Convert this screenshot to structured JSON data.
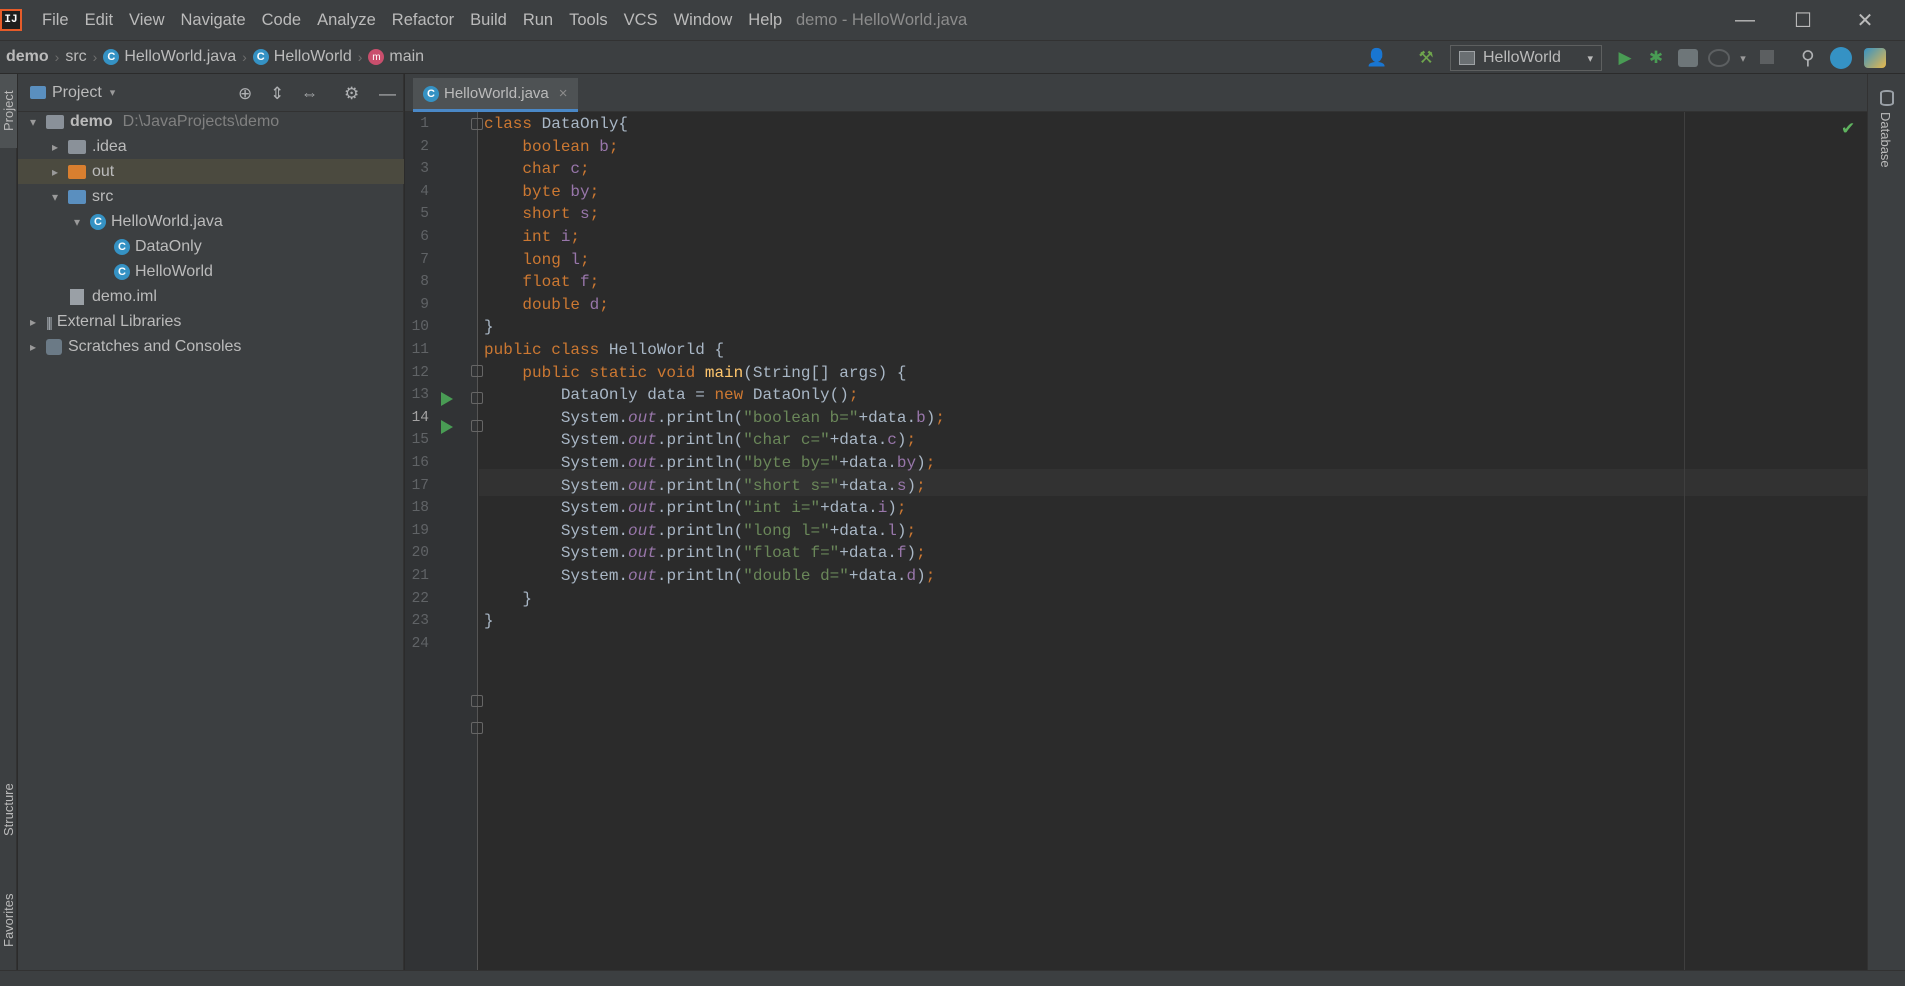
{
  "window": {
    "title": "demo - HelloWorld.java",
    "minimize_glyph": "—",
    "maximize_glyph": "☐",
    "close_glyph": "✕"
  },
  "menu": [
    "File",
    "Edit",
    "View",
    "Navigate",
    "Code",
    "Analyze",
    "Refactor",
    "Build",
    "Run",
    "Tools",
    "VCS",
    "Window",
    "Help"
  ],
  "breadcrumb": {
    "project": "demo",
    "folder": "src",
    "file": "HelloWorld.java",
    "class": "HelloWorld",
    "method": "main"
  },
  "toolbar": {
    "run_config": "HelloWorld"
  },
  "icons": {
    "class_glyph": "C",
    "method_glyph": "m",
    "chevron_right": "›",
    "chevron_expand": "▾",
    "chevron_collapse": "▸",
    "run": "▶",
    "debug": "✱",
    "search": "⚲",
    "hammer": "⚒",
    "user": "👤",
    "check": "✔",
    "gear": "⚙",
    "target": "⊕",
    "expand_all": "⇕",
    "collapse_all": "⇔",
    "hide": "—",
    "close_tab": "×"
  },
  "side_tabs": {
    "project": "Project",
    "structure": "Structure",
    "favorites": "Favorites",
    "database": "Database"
  },
  "project_panel": {
    "title": "Project",
    "tree": [
      {
        "label": "demo",
        "hint": "D:\\JavaProjects\\demo"
      },
      {
        "label": ".idea"
      },
      {
        "label": "out"
      },
      {
        "label": "src"
      },
      {
        "label": "HelloWorld.java"
      },
      {
        "label": "DataOnly"
      },
      {
        "label": "HelloWorld"
      },
      {
        "label": "demo.iml"
      },
      {
        "label": "External Libraries"
      },
      {
        "label": "Scratches and Consoles"
      }
    ]
  },
  "editor": {
    "tab_label": "HelloWorld.java",
    "current_line": 14,
    "line_numbers": [
      "1",
      "2",
      "3",
      "4",
      "5",
      "6",
      "7",
      "8",
      "9",
      "10",
      "11",
      "12",
      "13",
      "14",
      "15",
      "16",
      "17",
      "18",
      "19",
      "20",
      "21",
      "22",
      "23",
      "24"
    ],
    "lines": [
      [
        [
          "kw",
          "class "
        ],
        [
          "pl",
          "DataOnly{"
        ]
      ],
      [
        [
          "kw",
          "    boolean "
        ],
        [
          "fld",
          "b"
        ],
        [
          "kw",
          ";"
        ]
      ],
      [
        [
          "kw",
          "    char "
        ],
        [
          "fld",
          "c"
        ],
        [
          "kw",
          ";"
        ]
      ],
      [
        [
          "kw",
          "    byte "
        ],
        [
          "fld",
          "by"
        ],
        [
          "kw",
          ";"
        ]
      ],
      [
        [
          "kw",
          "    short "
        ],
        [
          "fld",
          "s"
        ],
        [
          "kw",
          ";"
        ]
      ],
      [
        [
          "kw",
          "    int "
        ],
        [
          "fld",
          "i"
        ],
        [
          "kw",
          ";"
        ]
      ],
      [
        [
          "kw",
          "    long "
        ],
        [
          "fld",
          "l"
        ],
        [
          "kw",
          ";"
        ]
      ],
      [
        [
          "kw",
          "    float "
        ],
        [
          "fld",
          "f"
        ],
        [
          "kw",
          ";"
        ]
      ],
      [
        [
          "kw",
          "    double "
        ],
        [
          "fld",
          "d"
        ],
        [
          "kw",
          ";"
        ]
      ],
      [
        [
          "pl",
          "}"
        ]
      ],
      [
        [
          "kw",
          "public class "
        ],
        [
          "pl",
          "HelloWorld {"
        ]
      ],
      [
        [
          "kw",
          "    public static void "
        ],
        [
          "fn",
          "main"
        ],
        [
          "pl",
          "(String[] args) {"
        ]
      ],
      [
        [
          "pl",
          "        DataOnly data = "
        ],
        [
          "kw",
          "new "
        ],
        [
          "pl",
          "DataOnly()"
        ],
        [
          "kw",
          ";"
        ]
      ],
      [
        [
          "pl",
          "        System."
        ],
        [
          "sfld",
          "out"
        ],
        [
          "pl",
          ".println("
        ],
        [
          "str",
          "\"boolean b=\""
        ],
        [
          "pl",
          "+data."
        ],
        [
          "fld",
          "b"
        ],
        [
          "pl",
          ")"
        ],
        [
          "kw",
          ";"
        ]
      ],
      [
        [
          "pl",
          "        System."
        ],
        [
          "sfld",
          "out"
        ],
        [
          "pl",
          ".println("
        ],
        [
          "str",
          "\"char c=\""
        ],
        [
          "pl",
          "+data."
        ],
        [
          "fld",
          "c"
        ],
        [
          "pl",
          ")"
        ],
        [
          "kw",
          ";"
        ]
      ],
      [
        [
          "pl",
          "        System."
        ],
        [
          "sfld",
          "out"
        ],
        [
          "pl",
          ".println("
        ],
        [
          "str",
          "\"byte by=\""
        ],
        [
          "pl",
          "+data."
        ],
        [
          "fld",
          "by"
        ],
        [
          "pl",
          ")"
        ],
        [
          "kw",
          ";"
        ]
      ],
      [
        [
          "pl",
          "        System."
        ],
        [
          "sfld",
          "out"
        ],
        [
          "pl",
          ".println("
        ],
        [
          "str",
          "\"short s=\""
        ],
        [
          "pl",
          "+data."
        ],
        [
          "fld",
          "s"
        ],
        [
          "pl",
          ")"
        ],
        [
          "kw",
          ";"
        ]
      ],
      [
        [
          "pl",
          "        System."
        ],
        [
          "sfld",
          "out"
        ],
        [
          "pl",
          ".println("
        ],
        [
          "str",
          "\"int i=\""
        ],
        [
          "pl",
          "+data."
        ],
        [
          "fld",
          "i"
        ],
        [
          "pl",
          ")"
        ],
        [
          "kw",
          ";"
        ]
      ],
      [
        [
          "pl",
          "        System."
        ],
        [
          "sfld",
          "out"
        ],
        [
          "pl",
          ".println("
        ],
        [
          "str",
          "\"long l=\""
        ],
        [
          "pl",
          "+data."
        ],
        [
          "fld",
          "l"
        ],
        [
          "pl",
          ")"
        ],
        [
          "kw",
          ";"
        ]
      ],
      [
        [
          "pl",
          "        System."
        ],
        [
          "sfld",
          "out"
        ],
        [
          "pl",
          ".println("
        ],
        [
          "str",
          "\"float f=\""
        ],
        [
          "pl",
          "+data."
        ],
        [
          "fld",
          "f"
        ],
        [
          "pl",
          ")"
        ],
        [
          "kw",
          ";"
        ]
      ],
      [
        [
          "pl",
          "        System."
        ],
        [
          "sfld",
          "out"
        ],
        [
          "pl",
          ".println("
        ],
        [
          "str",
          "\"double d=\""
        ],
        [
          "pl",
          "+data."
        ],
        [
          "fld",
          "d"
        ],
        [
          "pl",
          ")"
        ],
        [
          "kw",
          ";"
        ]
      ],
      [
        [
          "pl",
          "    }"
        ]
      ],
      [
        [
          "pl",
          "}"
        ]
      ],
      [
        [
          "pl",
          ""
        ]
      ]
    ]
  },
  "colors": {
    "keyword": "#cc7832",
    "string": "#6a8759",
    "field": "#9876aa",
    "method": "#ffc66d",
    "plain": "#a9b7c6",
    "run_green": "#499c54",
    "accent_blue": "#4a88c7"
  }
}
